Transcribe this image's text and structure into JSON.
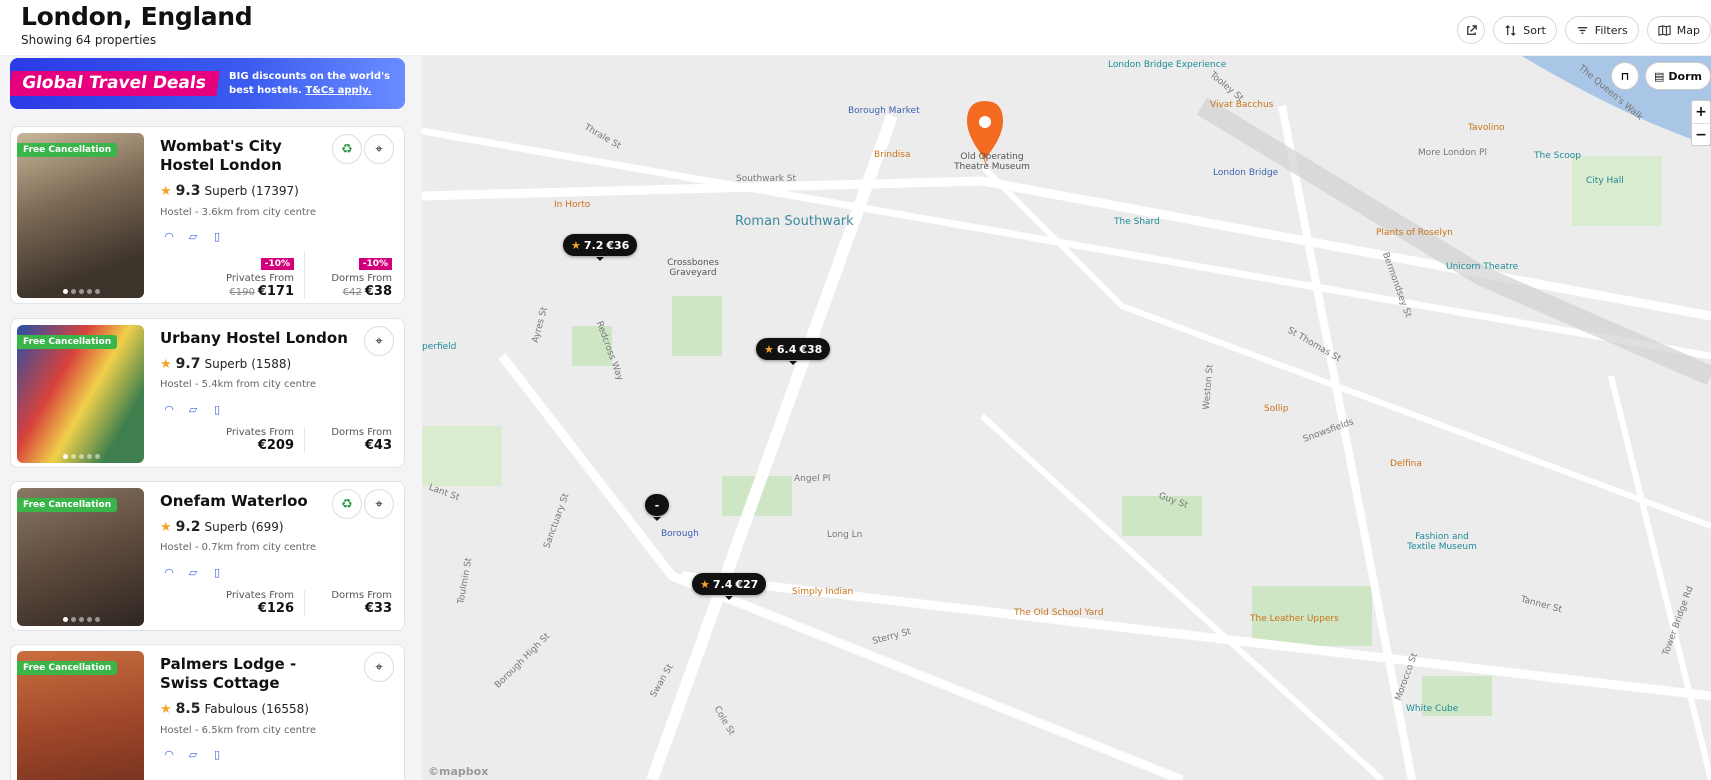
{
  "header": {
    "title": "London, England",
    "subtitle": "Showing 64 properties"
  },
  "actions": {
    "share_icon": "share-icon",
    "sort": "Sort",
    "filters": "Filters",
    "map": "Map"
  },
  "promo": {
    "tag": "Global Travel Deals",
    "text": "BIG discounts on the world's best hostels.",
    "link": "T&Cs apply."
  },
  "listings": [
    {
      "name": "Wombat's City Hostel London",
      "free": "Free Cancellation",
      "score": "9.3",
      "rating_word": "Superb",
      "reviews": "(17397)",
      "meta": "Hostel - 3.6km from city centre",
      "eco": true,
      "privates_label": "Privates From",
      "privates_old": "€190",
      "privates": "€171",
      "privates_disc": "-10%",
      "dorms_label": "Dorms From",
      "dorms_old": "€42",
      "dorms": "€38",
      "dorms_disc": "-10%"
    },
    {
      "name": "Urbany Hostel London",
      "free": "Free Cancellation",
      "score": "9.7",
      "rating_word": "Superb",
      "reviews": "(1588)",
      "meta": "Hostel - 5.4km from city centre",
      "eco": false,
      "privates_label": "Privates From",
      "privates": "€209",
      "dorms_label": "Dorms From",
      "dorms": "€43"
    },
    {
      "name": "Onefam Waterloo",
      "free": "Free Cancellation",
      "score": "9.2",
      "rating_word": "Superb",
      "reviews": "(699)",
      "meta": "Hostel - 0.7km from city centre",
      "eco": true,
      "privates_label": "Privates From",
      "privates": "€126",
      "dorms_label": "Dorms From",
      "dorms": "€33"
    },
    {
      "name": "Palmers Lodge - Swiss Cottage",
      "free": "Free Cancellation",
      "score": "8.5",
      "rating_word": "Fabulous",
      "reviews": "(16558)",
      "meta": "Hostel - 6.5km from city centre",
      "eco": false
    }
  ],
  "map": {
    "controls": {
      "bookmark_icon": "bookmark-icon",
      "dorm": "Dorm",
      "zoom_in": "+",
      "zoom_out": "−"
    },
    "pins": [
      {
        "score": "7.2",
        "price": "€36"
      },
      {
        "score": "6.4",
        "price": "€38"
      },
      {
        "score": "7.4",
        "price": "€27"
      },
      {
        "score": "-",
        "price": ""
      }
    ],
    "labels": {
      "district": "Roman Southwark",
      "southwark_st": "Southwark St",
      "long_ln": "Long Ln",
      "borough_market": "Borough Market",
      "london_bridge_exp": "London Bridge Experience",
      "vivat": "Vivat Bacchus",
      "tavolino": "Tavolino",
      "more_london": "More London Pl",
      "the_scoop": "The Scoop",
      "city_hall": "City Hall",
      "brindisa": "Brindisa",
      "old_theatre": "Old Operating Theatre Museum",
      "london_bridge": "London Bridge",
      "in_horto": "In Horto",
      "the_shard": "The Shard",
      "plants": "Plants of Roselyn",
      "unicorn": "Unicorn Theatre",
      "crossbones": "Crossbones Graveyard",
      "sollip": "Sollip",
      "delfina": "Delfina",
      "borough": "Borough",
      "simply_indian": "Simply Indian",
      "old_school_yard": "The Old School Yard",
      "leather_uppers": "The Leather Uppers",
      "fashion_museum": "Fashion and Textile Museum",
      "white_cube": "White Cube",
      "queens_walk": "The Queen's Walk",
      "tooley": "Tooley St",
      "st_thomas": "St Thomas St",
      "bermondsey": "Bermondsey St",
      "tower_bridge_rd": "Tower Bridge Rd",
      "tanner": "Tanner St",
      "guy_st": "Guy St",
      "snowsfields": "Snowsfields",
      "angel_pl": "Angel Pl",
      "sterry": "Sterry St",
      "borough_high": "Borough High St",
      "thrale": "Thrale St",
      "lant": "Lant St",
      "sanctuary": "Sanctuary St",
      "redcross": "Redcross Way",
      "ayres": "Ayres St",
      "weston": "Weston St",
      "swan": "Swan St",
      "cole": "Cole St",
      "morocco": "Morocco St",
      "perfield": "perfield",
      "tolmin": "Toulmin St",
      "mapbox": "©mapbox"
    }
  }
}
